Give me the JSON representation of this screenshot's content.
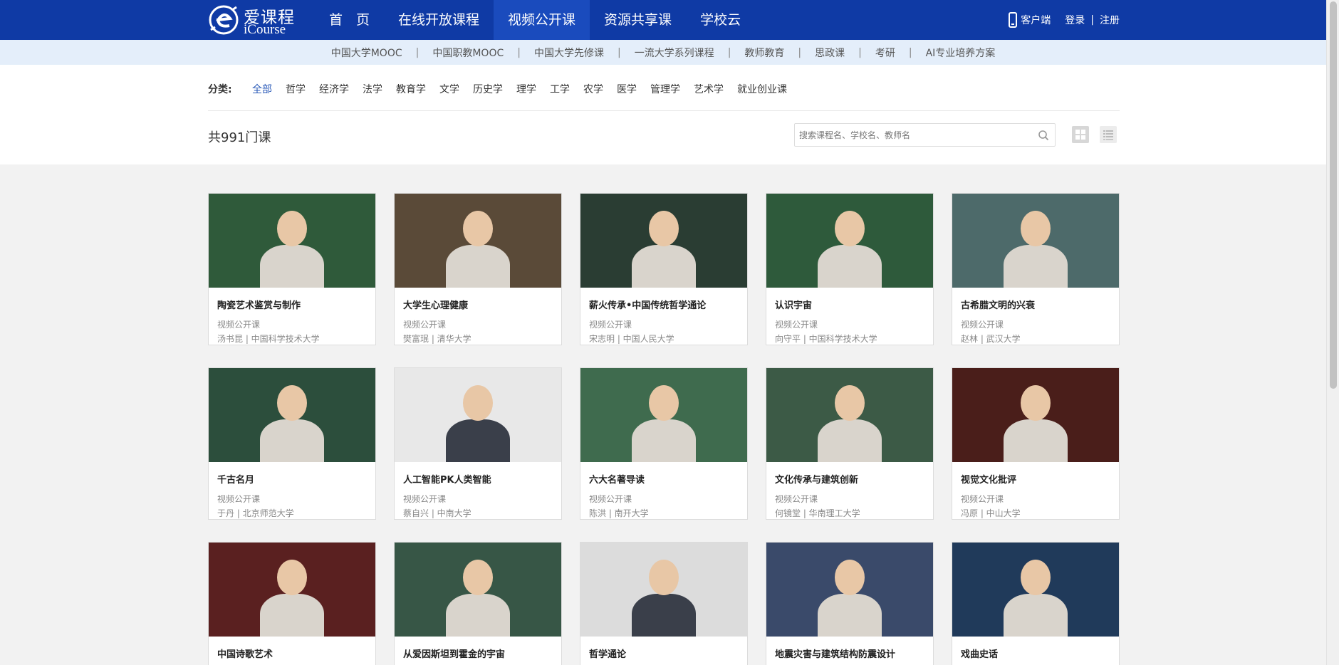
{
  "brand": {
    "name_cn": "爱课程",
    "name_en": "iCourse"
  },
  "main_nav": [
    {
      "label": "首　页",
      "active": false
    },
    {
      "label": "在线开放课程",
      "active": false
    },
    {
      "label": "视频公开课",
      "active": true
    },
    {
      "label": "资源共享课",
      "active": false
    },
    {
      "label": "学校云",
      "active": false
    }
  ],
  "top_right": {
    "client": "客户端",
    "login": "登录",
    "separator": "|",
    "register": "注册"
  },
  "sub_nav": [
    "中国大学MOOC",
    "中国职教MOOC",
    "中国大学先修课",
    "一流大学系列课程",
    "教师教育",
    "思政课",
    "考研",
    "AI专业培养方案"
  ],
  "sub_nav_separator": "|",
  "categories": {
    "label": "分类:",
    "items": [
      "全部",
      "哲学",
      "经济学",
      "法学",
      "教育学",
      "文学",
      "历史学",
      "理学",
      "工学",
      "农学",
      "医学",
      "管理学",
      "艺术学",
      "就业创业课"
    ],
    "active_index": 0
  },
  "count_text": "共991门课",
  "search": {
    "placeholder": "搜索课程名、学校名、教师名",
    "value": ""
  },
  "courses": [
    {
      "title": "陶瓷艺术鉴赏与制作",
      "type": "视频公开课",
      "meta": "汤书昆 | 中国科学技术大学",
      "bg": "#2f5a3a"
    },
    {
      "title": "大学生心理健康",
      "type": "视频公开课",
      "meta": "樊富珉 | 清华大学",
      "bg": "#5a4a38"
    },
    {
      "title": "薪火传承•中国传统哲学通论",
      "type": "视频公开课",
      "meta": "宋志明 | 中国人民大学",
      "bg": "#2a3d33"
    },
    {
      "title": "认识宇宙",
      "type": "视频公开课",
      "meta": "向守平 | 中国科学技术大学",
      "bg": "#2e5a3b"
    },
    {
      "title": "古希腊文明的兴衰",
      "type": "视频公开课",
      "meta": "赵林 | 武汉大学",
      "bg": "#4d6a6a"
    },
    {
      "title": "千古名月",
      "type": "视频公开课",
      "meta": "于丹 | 北京师范大学",
      "bg": "#2c4e3c"
    },
    {
      "title": "人工智能PK人类智能",
      "type": "视频公开课",
      "meta": "蔡自兴 | 中南大学",
      "bg": "#e8e8e8"
    },
    {
      "title": "六大名著导读",
      "type": "视频公开课",
      "meta": "陈洪 | 南开大学",
      "bg": "#3f6b4e"
    },
    {
      "title": "文化传承与建筑创新",
      "type": "视频公开课",
      "meta": "何镜堂 | 华南理工大学",
      "bg": "#3c5a46"
    },
    {
      "title": "视觉文化批评",
      "type": "视频公开课",
      "meta": "冯原 | 中山大学",
      "bg": "#4a1e1a"
    },
    {
      "title": "中国诗歌艺术",
      "type": "",
      "meta": "",
      "bg": "#5a2020"
    },
    {
      "title": "从爱因斯坦到霍金的宇宙",
      "type": "",
      "meta": "",
      "bg": "#375646"
    },
    {
      "title": "哲学通论",
      "type": "",
      "meta": "",
      "bg": "#dcdcdc"
    },
    {
      "title": "地震灾害与建筑结构防震设计",
      "type": "",
      "meta": "",
      "bg": "#3a4a6a"
    },
    {
      "title": "戏曲史话",
      "type": "",
      "meta": "",
      "bg": "#203a5a"
    }
  ],
  "colors": {
    "header": "#0f3aa5",
    "header_active": "#1a4bbd",
    "subnav": "#e4eefa",
    "category_active": "#2a5ab8"
  },
  "icons": [
    "phone-icon",
    "search-icon",
    "grid-view-icon",
    "list-view-icon"
  ]
}
